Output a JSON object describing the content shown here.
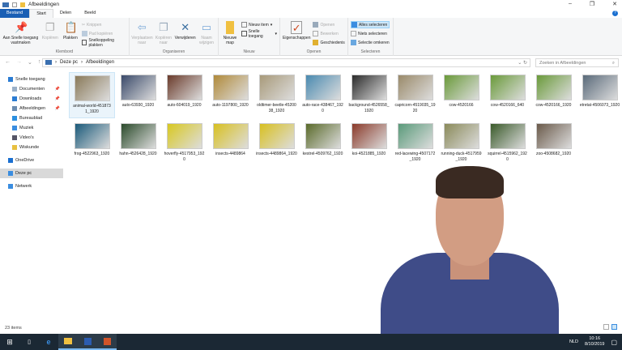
{
  "window": {
    "title": "Afbeeldingen",
    "minimize": "–",
    "maximize": "❐",
    "close": "✕",
    "help": "?"
  },
  "tabs": [
    {
      "label": "Bestand"
    },
    {
      "label": "Start"
    },
    {
      "label": "Delen"
    },
    {
      "label": "Beeld"
    }
  ],
  "ribbon": {
    "klembord": {
      "label": "Klembord",
      "pin": "Aan Snelle toegang vastmaken",
      "copy": "Kopiëren",
      "paste": "Plakken",
      "cut": "Knippen",
      "copy_path": "Pad kopiëren",
      "paste_shortcut": "Snelkoppeling plakken"
    },
    "organiseren": {
      "label": "Organiseren",
      "move": "Verplaatsen naar",
      "copy_to": "Kopiëren naar",
      "delete": "Verwijderen",
      "rename": "Naam wijzigen"
    },
    "nieuw": {
      "label": "Nieuw",
      "new_folder": "Nieuwe map",
      "new_item": "Nieuw item",
      "easy_access": "Snelle toegang"
    },
    "openen": {
      "label": "Openen",
      "properties": "Eigenschappen",
      "open": "Openen",
      "edit": "Bewerken",
      "history": "Geschiedenis"
    },
    "selecteren": {
      "label": "Selecteren",
      "select_all": "Alles selecteren",
      "select_none": "Niets selecteren",
      "invert": "Selectie omkeren"
    }
  },
  "address": {
    "crumbs": [
      "Deze pc",
      "Afbeeldingen"
    ],
    "search_placeholder": "Zoeken in Afbeeldingen"
  },
  "sidebar": [
    {
      "label": "Snelle toegang",
      "color": "#2b7cd3"
    },
    {
      "label": "Documenten",
      "color": "#9bb0c8",
      "pinned": true
    },
    {
      "label": "Downloads",
      "color": "#2b7cd3",
      "pinned": true
    },
    {
      "label": "Afbeeldingen",
      "color": "#6b8cb0",
      "pinned": true
    },
    {
      "label": "Bureaublad",
      "color": "#2b8fe0"
    },
    {
      "label": "Muziek",
      "color": "#3a8de0"
    },
    {
      "label": "Video's",
      "color": "#556"
    },
    {
      "label": "Wiskunde",
      "color": "#e8c040"
    },
    {
      "label": "OneDrive",
      "color": "#1a6fd0"
    },
    {
      "label": "Deze pc",
      "color": "#3a8de0"
    },
    {
      "label": "Netwerk",
      "color": "#3a8de0"
    }
  ],
  "files": [
    {
      "name": "animal-world-4518731_1920",
      "color": "#8a7a5a"
    },
    {
      "name": "auto-63930_1920",
      "color": "#3a4a6a"
    },
    {
      "name": "auto-604019_1920",
      "color": "#6a3a2a"
    },
    {
      "name": "auto-1197800_1920",
      "color": "#b08a3a"
    },
    {
      "name": "oldtimer-beetle-4520038_1920",
      "color": "#a89a7a"
    },
    {
      "name": "auto-race-438467_1920",
      "color": "#4a8ab0"
    },
    {
      "name": "background-4526558_1920",
      "color": "#2a2a2a"
    },
    {
      "name": "capricorn-4519035_1920",
      "color": "#9a8a6a"
    },
    {
      "name": "cow-4520166",
      "color": "#6a9a3a"
    },
    {
      "name": "cow-4520166_640",
      "color": "#6a9a3a"
    },
    {
      "name": "cow-4520166_1920",
      "color": "#6a9a3a"
    },
    {
      "name": "etretat-4506073_1920",
      "color": "#5a6a7a"
    },
    {
      "name": "frog-4522963_1920",
      "color": "#1a5a7a"
    },
    {
      "name": "hahn-4526428_1920",
      "color": "#2a4a2a"
    },
    {
      "name": "hoverfly-4517953_1920",
      "color": "#d8c820"
    },
    {
      "name": "insects-4489864",
      "color": "#d8c020"
    },
    {
      "name": "insects-4489864_1920",
      "color": "#d8c020"
    },
    {
      "name": "kestrel-4509762_1920",
      "color": "#5a6a2a"
    },
    {
      "name": "koi-4521885_1920",
      "color": "#8a3a2a"
    },
    {
      "name": "red-lacewing-4507172_1920",
      "color": "#5a9a7a"
    },
    {
      "name": "running-duck-4517959_1920",
      "color": "#8a8a5a"
    },
    {
      "name": "squirrel-4515962_1920",
      "color": "#3a5a2a"
    },
    {
      "name": "zoo-4508682_1920",
      "color": "#6a5a4a"
    }
  ],
  "status": {
    "count": "23 items"
  },
  "taskbar": {
    "lang": "NLD",
    "time": "10:16",
    "date": "8/10/2019"
  }
}
